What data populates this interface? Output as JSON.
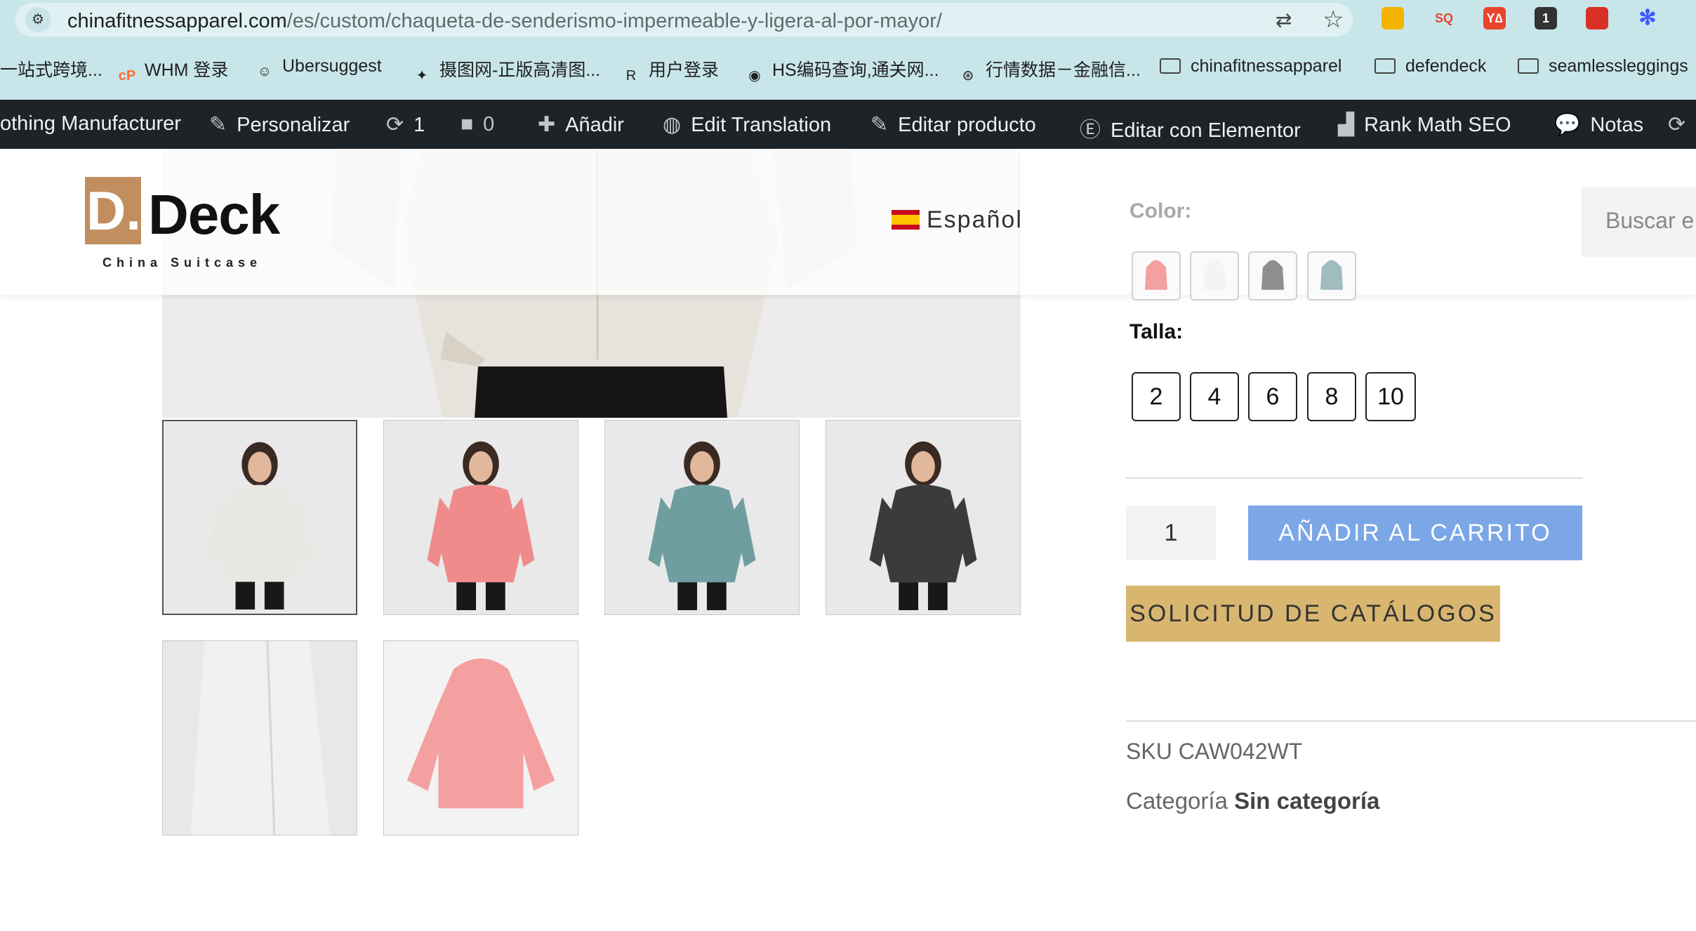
{
  "browser": {
    "url_host": "chinafitnessapparel.com",
    "url_path": "/es/custom/chaqueta-de-senderismo-impermeable-y-ligera-al-por-mayor/",
    "extensions": [
      {
        "name": "drive-icon",
        "color": "#f4b400",
        "glyph": ""
      },
      {
        "name": "sq-extension-icon",
        "color": "#ffffff",
        "glyph": "SQ"
      },
      {
        "name": "ya-extension-icon",
        "color": "#e8452c",
        "glyph": "Y∆"
      },
      {
        "name": "counter-extension-icon",
        "color": "#333333",
        "glyph": "1"
      },
      {
        "name": "calendar-extension-icon",
        "color": "#d93025",
        "glyph": ""
      },
      {
        "name": "spark-extension-icon",
        "color": "#3d5afe",
        "glyph": "✻"
      }
    ]
  },
  "bookmarks": [
    {
      "label": "一站式跨境...",
      "icon": ""
    },
    {
      "label": "WHM 登录",
      "icon": "cP"
    },
    {
      "label": "Ubersuggest",
      "icon": "☺"
    },
    {
      "label": "摄图网-正版高清图...",
      "icon": "✦"
    },
    {
      "label": "用户登录",
      "icon": "R"
    },
    {
      "label": "HS编码查询,通关网...",
      "icon": "◉"
    },
    {
      "label": "行情数据－金融信...",
      "icon": "⊛"
    },
    {
      "label": "chinafitnessapparel",
      "icon": "folder"
    },
    {
      "label": "defendeck",
      "icon": "folder"
    },
    {
      "label": "seamlessleggings",
      "icon": "folder"
    }
  ],
  "adminbar": {
    "site": "othing Manufacturer",
    "customize": "Personalizar",
    "updates": "1",
    "comments": "0",
    "add_new": "Añadir",
    "edit_translation": "Edit Translation",
    "edit_product": "Editar producto",
    "elementor": "Editar con Elementor",
    "rankmath": "Rank Math SEO",
    "notes": "Notas"
  },
  "header": {
    "logo_letter": "D.",
    "logo_word": "Deck",
    "logo_tagline": "China Suitcase",
    "language": "Español",
    "search_placeholder": "Buscar e"
  },
  "product": {
    "color_label": "Color:",
    "colors": [
      "#f2a0a0",
      "#f4f4f4",
      "#8e8e8e",
      "#9fbcbf"
    ],
    "size_label": "Talla:",
    "sizes": [
      "2",
      "4",
      "6",
      "8",
      "10"
    ],
    "quantity": "1",
    "add_to_cart": "AÑADIR AL CARRITO",
    "catalog_request": "SOLICITUD DE CATÁLOGOS",
    "sku_label": "SKU",
    "sku_value": "CAW042WT",
    "category_label": "Categoría",
    "category_value": "Sin categoría"
  },
  "gallery": {
    "thumbnails": [
      {
        "name": "thumb-white-jacket",
        "jacket": "#e9e7e2",
        "active": true
      },
      {
        "name": "thumb-pink-jacket",
        "jacket": "#ef8b8b"
      },
      {
        "name": "thumb-teal-jacket",
        "jacket": "#6f9ea0"
      },
      {
        "name": "thumb-black-jacket",
        "jacket": "#3b3b3d"
      },
      {
        "name": "thumb-white-side",
        "jacket": "#f1f1ef"
      },
      {
        "name": "thumb-pink-back",
        "jacket": "#f4a0a0"
      }
    ]
  }
}
